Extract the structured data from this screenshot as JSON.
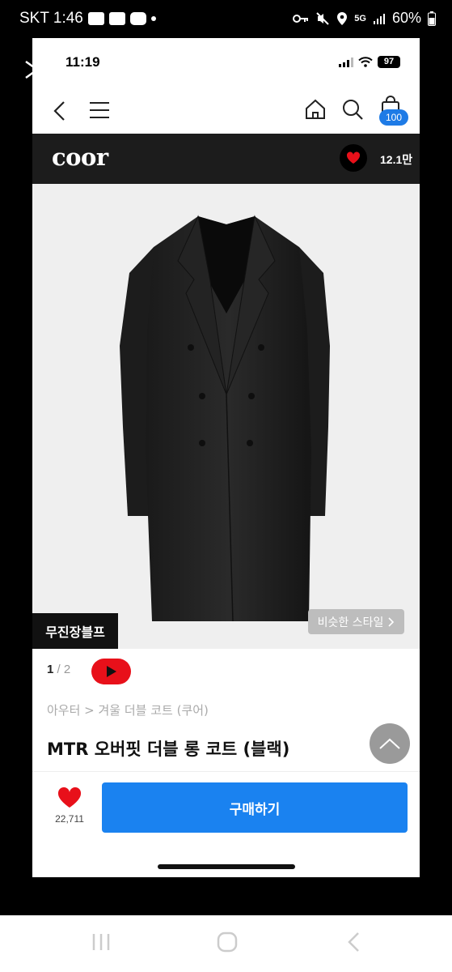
{
  "android_status": {
    "carrier_time": "SKT 1:46",
    "network": "5G",
    "battery": "60%"
  },
  "ios_status": {
    "time": "11:19",
    "battery": "97"
  },
  "nav": {
    "cart_count": "100"
  },
  "brand": {
    "logo": "coor",
    "like_count": "12.1만"
  },
  "product": {
    "brand_tag": "무진장블프",
    "similar_style_label": "비슷한 스타일",
    "pager_current": "1",
    "pager_total": "/ 2",
    "category": "아우터 > 겨울 더블 코트 (쿠어)",
    "title": "MTR 오버핏 더블 롱 코트 (블랙)"
  },
  "actions": {
    "wish_count": "22,711",
    "buy_label": "구매하기"
  },
  "colors": {
    "accent_blue": "#1a82f0",
    "heart_red": "#e8101a",
    "brand_bar": "#1c1c1c"
  }
}
